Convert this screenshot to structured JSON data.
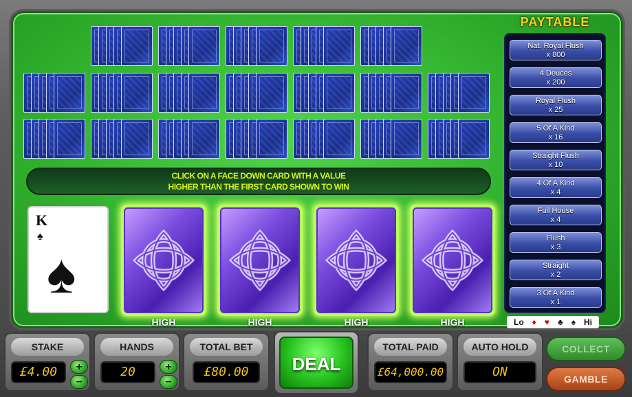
{
  "decks": {
    "row1": [
      1,
      2,
      3,
      4,
      5
    ],
    "row2": [
      1,
      2,
      3,
      4,
      5,
      6,
      7
    ],
    "row3": [
      1,
      2,
      3,
      4,
      5,
      6,
      7
    ]
  },
  "message": {
    "line1": "CLICK ON A FACE DOWN CARD WITH A VALUE",
    "line2": "HIGHER THAN THE FIRST CARD SHOWN TO WIN"
  },
  "first_card": {
    "rank": "K",
    "suit": "♠"
  },
  "hold_cards": [
    {
      "label": "HIGH"
    },
    {
      "label": "HIGH"
    },
    {
      "label": "HIGH"
    },
    {
      "label": "HIGH"
    }
  ],
  "paytable": {
    "title": "PAYTABLE",
    "rows": [
      {
        "hand": "Nat. Royal Flush",
        "payout": "x 800"
      },
      {
        "hand": "4 Deuces",
        "payout": "x 200"
      },
      {
        "hand": "Royal Flush",
        "payout": "x 25"
      },
      {
        "hand": "5 Of A Kind",
        "payout": "x 16"
      },
      {
        "hand": "Straight Flush",
        "payout": "x 10"
      },
      {
        "hand": "4 Of A Kind",
        "payout": "x 4"
      },
      {
        "hand": "Full House",
        "payout": "x 4"
      },
      {
        "hand": "Flush",
        "payout": "x 3"
      },
      {
        "hand": "Straight",
        "payout": "x 2"
      },
      {
        "hand": "3 Of A Kind",
        "payout": "x 1"
      }
    ]
  },
  "lohi": {
    "lo": "Lo",
    "diamond": "♦",
    "heart": "♥",
    "club": "♣",
    "spade": "♠",
    "hi": "Hi"
  },
  "controls": {
    "stake_label": "STAKE",
    "stake_value": "£4.00",
    "hands_label": "HANDS",
    "hands_value": "20",
    "total_bet_label": "TOTAL BET",
    "total_bet_value": "£80.00",
    "deal_label": "DEAL",
    "total_paid_label": "TOTAL PAID",
    "total_paid_value": "£64,000.00",
    "auto_hold_label": "AUTO HOLD",
    "auto_hold_value": "ON",
    "collect_label": "COLLECT",
    "gamble_label": "GAMBLE",
    "plus": "+",
    "minus": "−"
  },
  "colors": {
    "felt": "#2fae2b",
    "message_text": "#d9f21a",
    "paytable_title": "#f3d41b",
    "value_text": "#f4c21c",
    "card_back": "#1a2f8e",
    "hold_card_back": "#7b4ee0"
  }
}
